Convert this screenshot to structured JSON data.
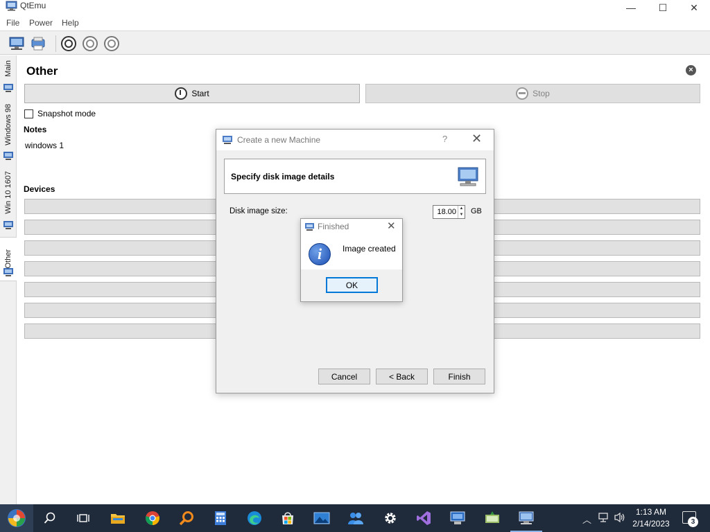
{
  "window": {
    "title": "QtEmu",
    "minimize": "—",
    "maximize": "☐",
    "close": "✕"
  },
  "menu": [
    "File",
    "Power",
    "Help"
  ],
  "toolbar": {
    "icons": [
      "new-machine-icon",
      "machine-settings-icon",
      "power-on-icon",
      "power-off-icon",
      "reset-icon"
    ]
  },
  "tabs": [
    {
      "label": "Main",
      "icon": "computer-icon"
    },
    {
      "label": "Windows 98",
      "icon": "computer-icon"
    },
    {
      "label": "Win 10 1607",
      "icon": "computer-icon"
    },
    {
      "label": "Other",
      "icon": "computer-icon",
      "active": true
    }
  ],
  "machine": {
    "name": "Other",
    "close_icon": "×",
    "start_label": "Start",
    "stop_label": "Stop",
    "snapshot_label": "Snapshot mode",
    "snapshot_checked": false,
    "notes_label": "Notes",
    "notes_text": "windows 1",
    "devices_label": "Devices",
    "device_count": 7
  },
  "wizard": {
    "title": "Create a new Machine",
    "help": "?",
    "close": "✕",
    "header": "Specify disk image details",
    "disk_size_label": "Disk image size:",
    "disk_size_value": "18.00",
    "disk_size_unit": "GB",
    "cancel_label": "Cancel",
    "back_label": "< Back",
    "finish_label": "Finish"
  },
  "message": {
    "title": "Finished",
    "close": "✕",
    "text": "Image created",
    "icon_glyph": "i",
    "ok_label": "OK"
  },
  "taskbar": {
    "apps": [
      "search",
      "task-view",
      "file-explorer",
      "chrome",
      "search-app",
      "calculator",
      "edge",
      "store",
      "photos",
      "people",
      "settings",
      "visual-studio",
      "remote-desktop",
      "network-app",
      "qtemu"
    ],
    "time": "1:13 AM",
    "date": "2/14/2023",
    "notification_count": "3",
    "accent": "#8ab4e8"
  }
}
